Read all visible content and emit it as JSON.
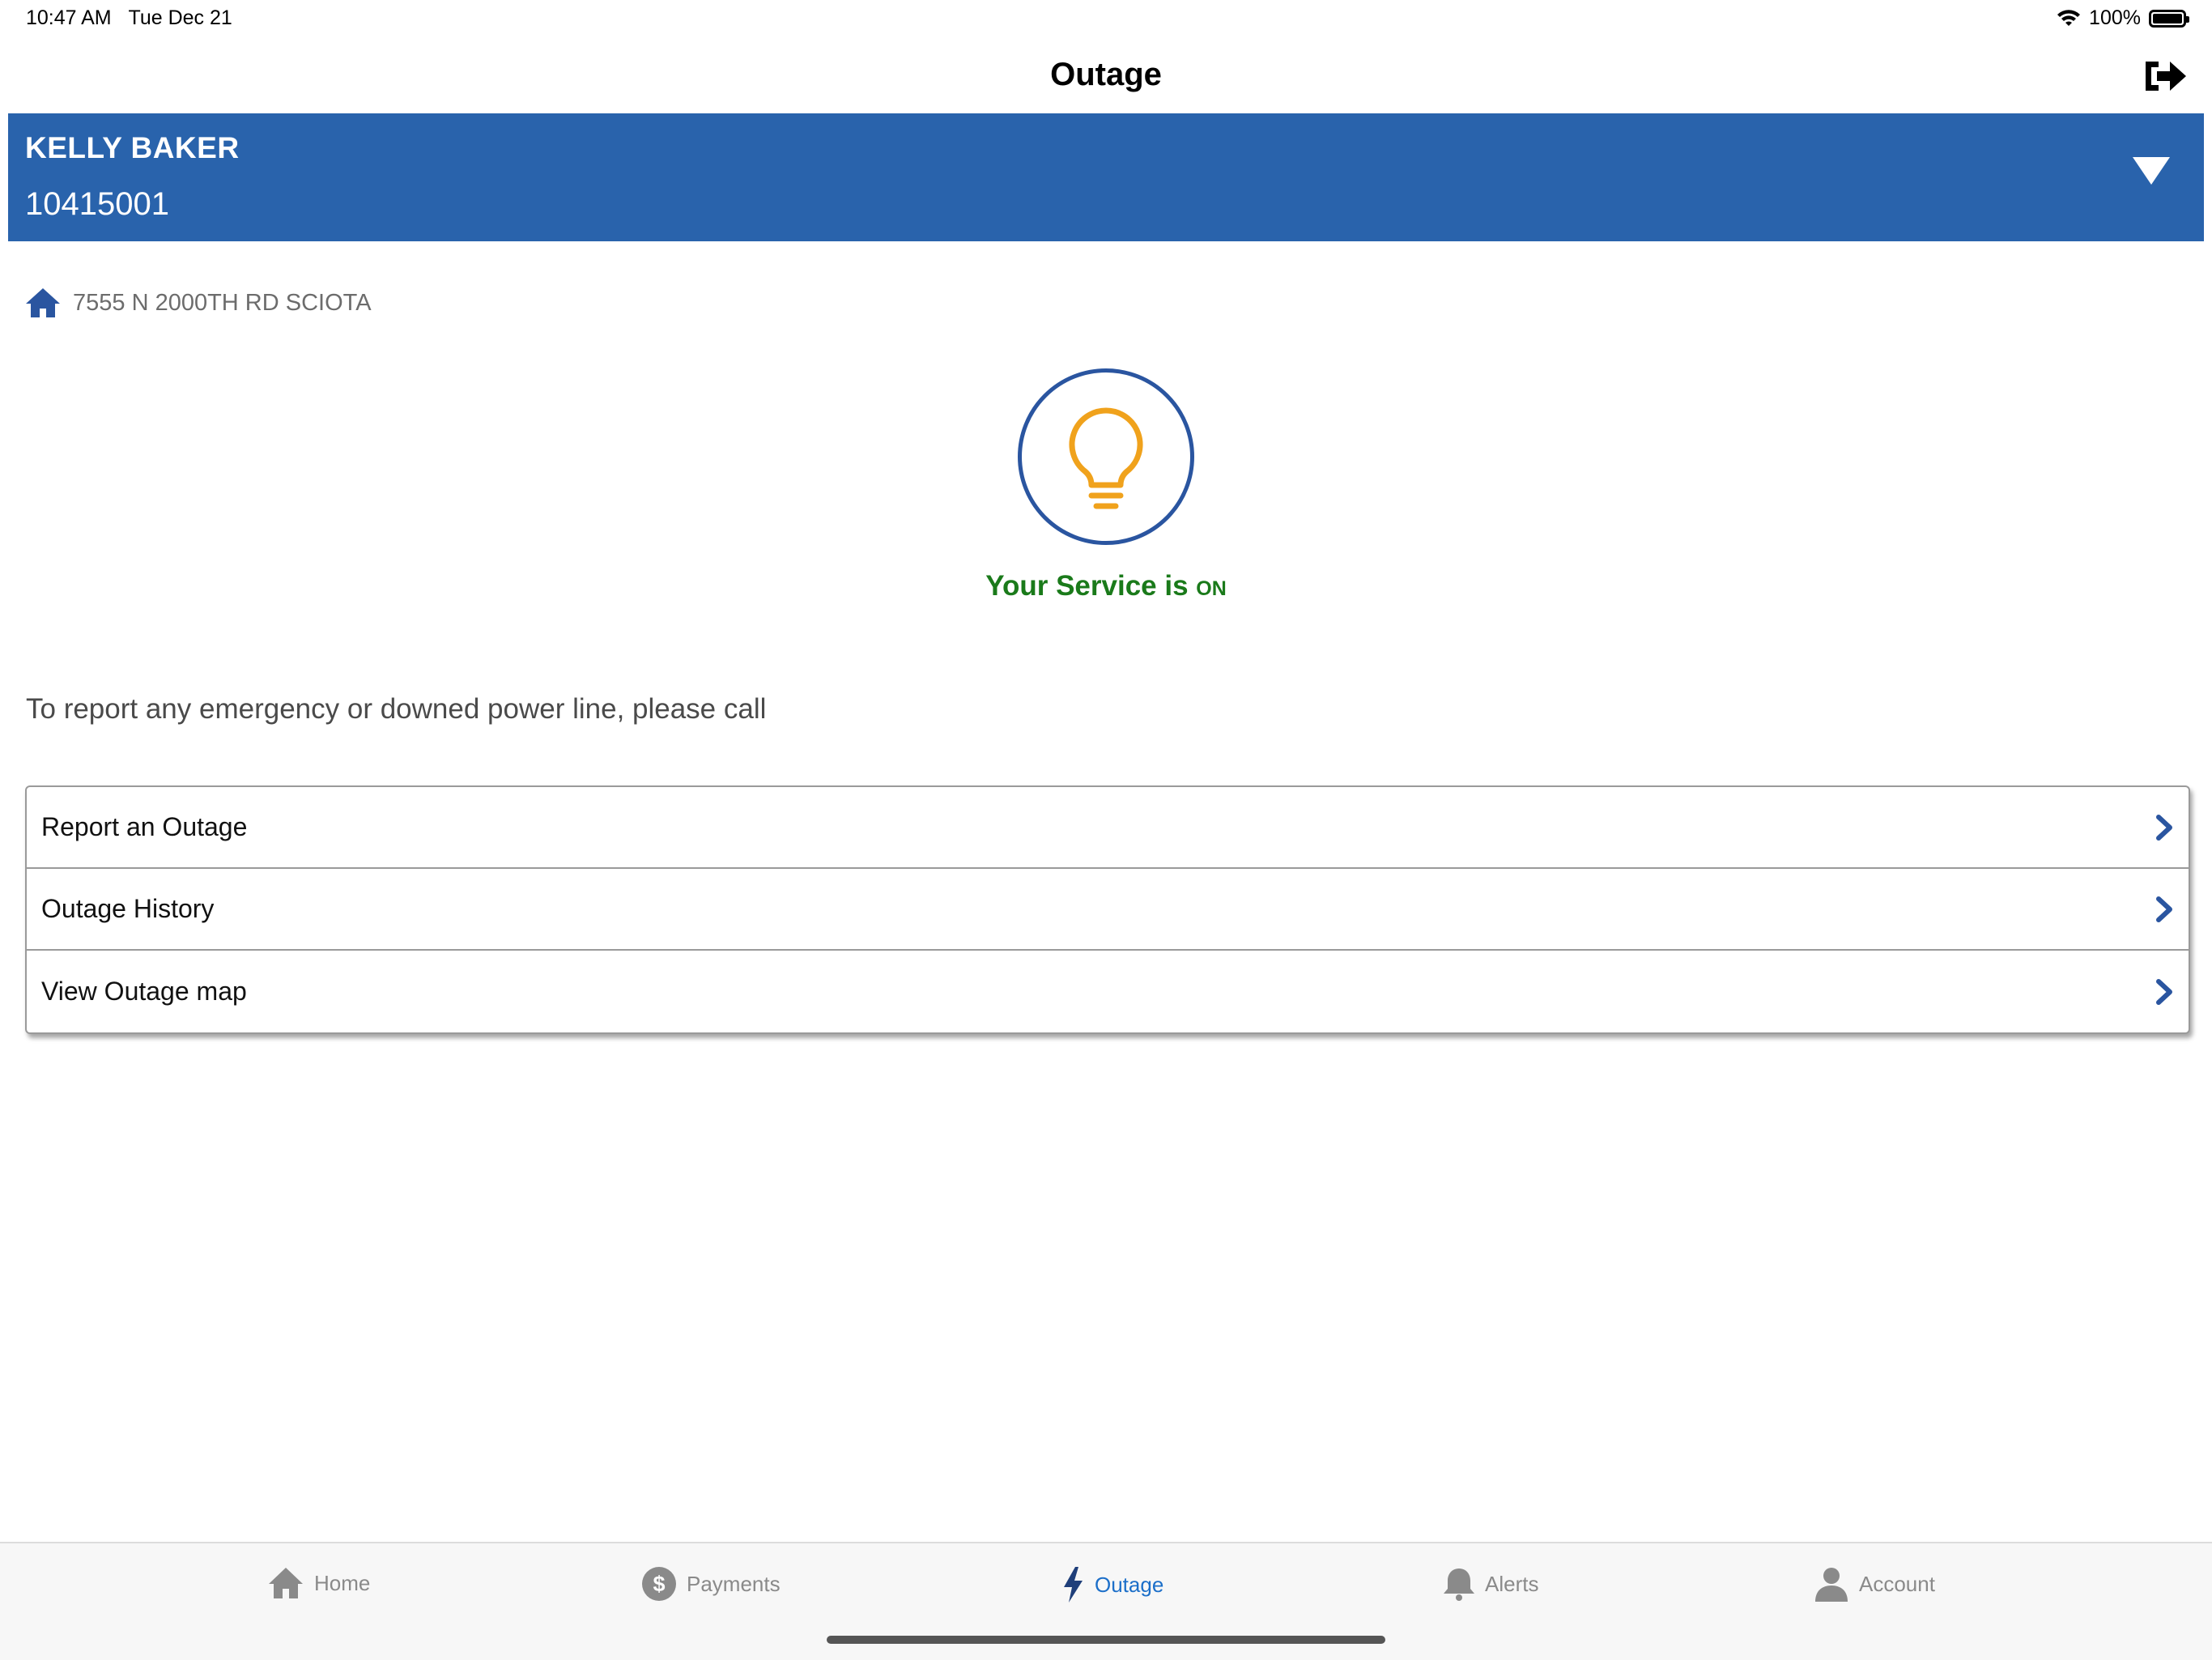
{
  "status_bar": {
    "time": "10:47 AM",
    "date": "Tue Dec 21",
    "battery": "100%"
  },
  "header": {
    "title": "Outage"
  },
  "account": {
    "name": "KELLY BAKER",
    "number": "10415001"
  },
  "address": "7555 N 2000TH RD SCIOTA",
  "service": {
    "prefix": "Your Service is",
    "state": "ON"
  },
  "emergency_text": "To report any emergency or downed power line, please call",
  "menu": {
    "items": [
      {
        "label": "Report an Outage"
      },
      {
        "label": "Outage History"
      },
      {
        "label": "View Outage map"
      }
    ]
  },
  "tabs": [
    {
      "label": "Home",
      "icon": "home-icon"
    },
    {
      "label": "Payments",
      "icon": "dollar-icon"
    },
    {
      "label": "Outage",
      "icon": "lightning-icon",
      "active": true
    },
    {
      "label": "Alerts",
      "icon": "bell-icon"
    },
    {
      "label": "Account",
      "icon": "person-icon"
    }
  ],
  "colors": {
    "banner": "#2963ac",
    "service_on": "#1a7a1a",
    "bulb": "#f0a21c",
    "tab_active": "#1c6fc9"
  }
}
